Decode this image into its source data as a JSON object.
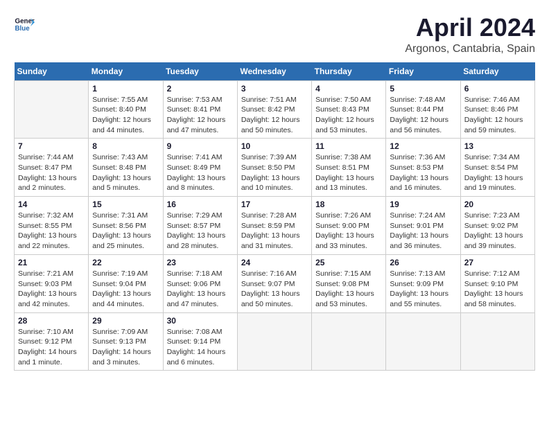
{
  "header": {
    "logo_line1": "General",
    "logo_line2": "Blue",
    "title": "April 2024",
    "subtitle": "Argonos, Cantabria, Spain"
  },
  "columns": [
    "Sunday",
    "Monday",
    "Tuesday",
    "Wednesday",
    "Thursday",
    "Friday",
    "Saturday"
  ],
  "weeks": [
    [
      {
        "day": "",
        "info": ""
      },
      {
        "day": "1",
        "info": "Sunrise: 7:55 AM\nSunset: 8:40 PM\nDaylight: 12 hours\nand 44 minutes."
      },
      {
        "day": "2",
        "info": "Sunrise: 7:53 AM\nSunset: 8:41 PM\nDaylight: 12 hours\nand 47 minutes."
      },
      {
        "day": "3",
        "info": "Sunrise: 7:51 AM\nSunset: 8:42 PM\nDaylight: 12 hours\nand 50 minutes."
      },
      {
        "day": "4",
        "info": "Sunrise: 7:50 AM\nSunset: 8:43 PM\nDaylight: 12 hours\nand 53 minutes."
      },
      {
        "day": "5",
        "info": "Sunrise: 7:48 AM\nSunset: 8:44 PM\nDaylight: 12 hours\nand 56 minutes."
      },
      {
        "day": "6",
        "info": "Sunrise: 7:46 AM\nSunset: 8:46 PM\nDaylight: 12 hours\nand 59 minutes."
      }
    ],
    [
      {
        "day": "7",
        "info": "Sunrise: 7:44 AM\nSunset: 8:47 PM\nDaylight: 13 hours\nand 2 minutes."
      },
      {
        "day": "8",
        "info": "Sunrise: 7:43 AM\nSunset: 8:48 PM\nDaylight: 13 hours\nand 5 minutes."
      },
      {
        "day": "9",
        "info": "Sunrise: 7:41 AM\nSunset: 8:49 PM\nDaylight: 13 hours\nand 8 minutes."
      },
      {
        "day": "10",
        "info": "Sunrise: 7:39 AM\nSunset: 8:50 PM\nDaylight: 13 hours\nand 10 minutes."
      },
      {
        "day": "11",
        "info": "Sunrise: 7:38 AM\nSunset: 8:51 PM\nDaylight: 13 hours\nand 13 minutes."
      },
      {
        "day": "12",
        "info": "Sunrise: 7:36 AM\nSunset: 8:53 PM\nDaylight: 13 hours\nand 16 minutes."
      },
      {
        "day": "13",
        "info": "Sunrise: 7:34 AM\nSunset: 8:54 PM\nDaylight: 13 hours\nand 19 minutes."
      }
    ],
    [
      {
        "day": "14",
        "info": "Sunrise: 7:32 AM\nSunset: 8:55 PM\nDaylight: 13 hours\nand 22 minutes."
      },
      {
        "day": "15",
        "info": "Sunrise: 7:31 AM\nSunset: 8:56 PM\nDaylight: 13 hours\nand 25 minutes."
      },
      {
        "day": "16",
        "info": "Sunrise: 7:29 AM\nSunset: 8:57 PM\nDaylight: 13 hours\nand 28 minutes."
      },
      {
        "day": "17",
        "info": "Sunrise: 7:28 AM\nSunset: 8:59 PM\nDaylight: 13 hours\nand 31 minutes."
      },
      {
        "day": "18",
        "info": "Sunrise: 7:26 AM\nSunset: 9:00 PM\nDaylight: 13 hours\nand 33 minutes."
      },
      {
        "day": "19",
        "info": "Sunrise: 7:24 AM\nSunset: 9:01 PM\nDaylight: 13 hours\nand 36 minutes."
      },
      {
        "day": "20",
        "info": "Sunrise: 7:23 AM\nSunset: 9:02 PM\nDaylight: 13 hours\nand 39 minutes."
      }
    ],
    [
      {
        "day": "21",
        "info": "Sunrise: 7:21 AM\nSunset: 9:03 PM\nDaylight: 13 hours\nand 42 minutes."
      },
      {
        "day": "22",
        "info": "Sunrise: 7:19 AM\nSunset: 9:04 PM\nDaylight: 13 hours\nand 44 minutes."
      },
      {
        "day": "23",
        "info": "Sunrise: 7:18 AM\nSunset: 9:06 PM\nDaylight: 13 hours\nand 47 minutes."
      },
      {
        "day": "24",
        "info": "Sunrise: 7:16 AM\nSunset: 9:07 PM\nDaylight: 13 hours\nand 50 minutes."
      },
      {
        "day": "25",
        "info": "Sunrise: 7:15 AM\nSunset: 9:08 PM\nDaylight: 13 hours\nand 53 minutes."
      },
      {
        "day": "26",
        "info": "Sunrise: 7:13 AM\nSunset: 9:09 PM\nDaylight: 13 hours\nand 55 minutes."
      },
      {
        "day": "27",
        "info": "Sunrise: 7:12 AM\nSunset: 9:10 PM\nDaylight: 13 hours\nand 58 minutes."
      }
    ],
    [
      {
        "day": "28",
        "info": "Sunrise: 7:10 AM\nSunset: 9:12 PM\nDaylight: 14 hours\nand 1 minute."
      },
      {
        "day": "29",
        "info": "Sunrise: 7:09 AM\nSunset: 9:13 PM\nDaylight: 14 hours\nand 3 minutes."
      },
      {
        "day": "30",
        "info": "Sunrise: 7:08 AM\nSunset: 9:14 PM\nDaylight: 14 hours\nand 6 minutes."
      },
      {
        "day": "",
        "info": ""
      },
      {
        "day": "",
        "info": ""
      },
      {
        "day": "",
        "info": ""
      },
      {
        "day": "",
        "info": ""
      }
    ]
  ]
}
